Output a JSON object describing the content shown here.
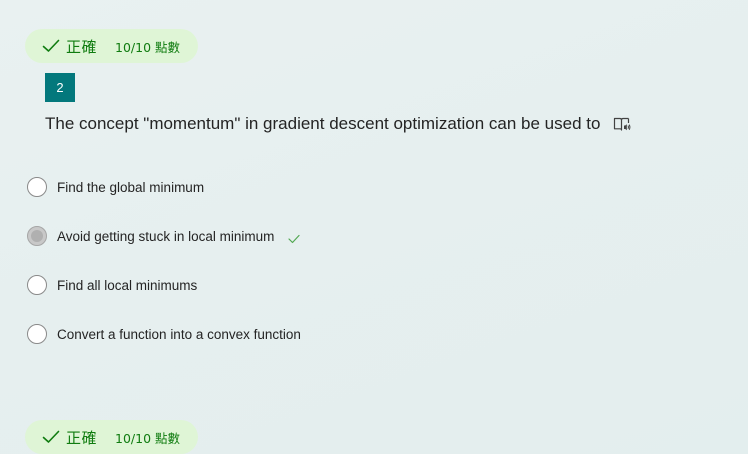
{
  "colors": {
    "accent": "#03787c",
    "correct_green": "#107c10",
    "badge_background": "#dff5d6"
  },
  "top_badge": {
    "icon": "checkmark-icon",
    "status": "正確",
    "points": "10/10 點數"
  },
  "question": {
    "number": "2",
    "text": "The concept \"momentum\" in gradient descent optimization can be used to",
    "reader_icon": "immersive-reader-icon"
  },
  "options": [
    {
      "label": "Find the global minimum",
      "selected": false,
      "correct": false
    },
    {
      "label": "Avoid getting stuck in local minimum",
      "selected": true,
      "correct": true
    },
    {
      "label": "Find all local minimums",
      "selected": false,
      "correct": false
    },
    {
      "label": "Convert a function into a convex function",
      "selected": false,
      "correct": false
    }
  ],
  "bottom_badge": {
    "icon": "checkmark-icon",
    "status": "正確",
    "points": "10/10 點數"
  }
}
